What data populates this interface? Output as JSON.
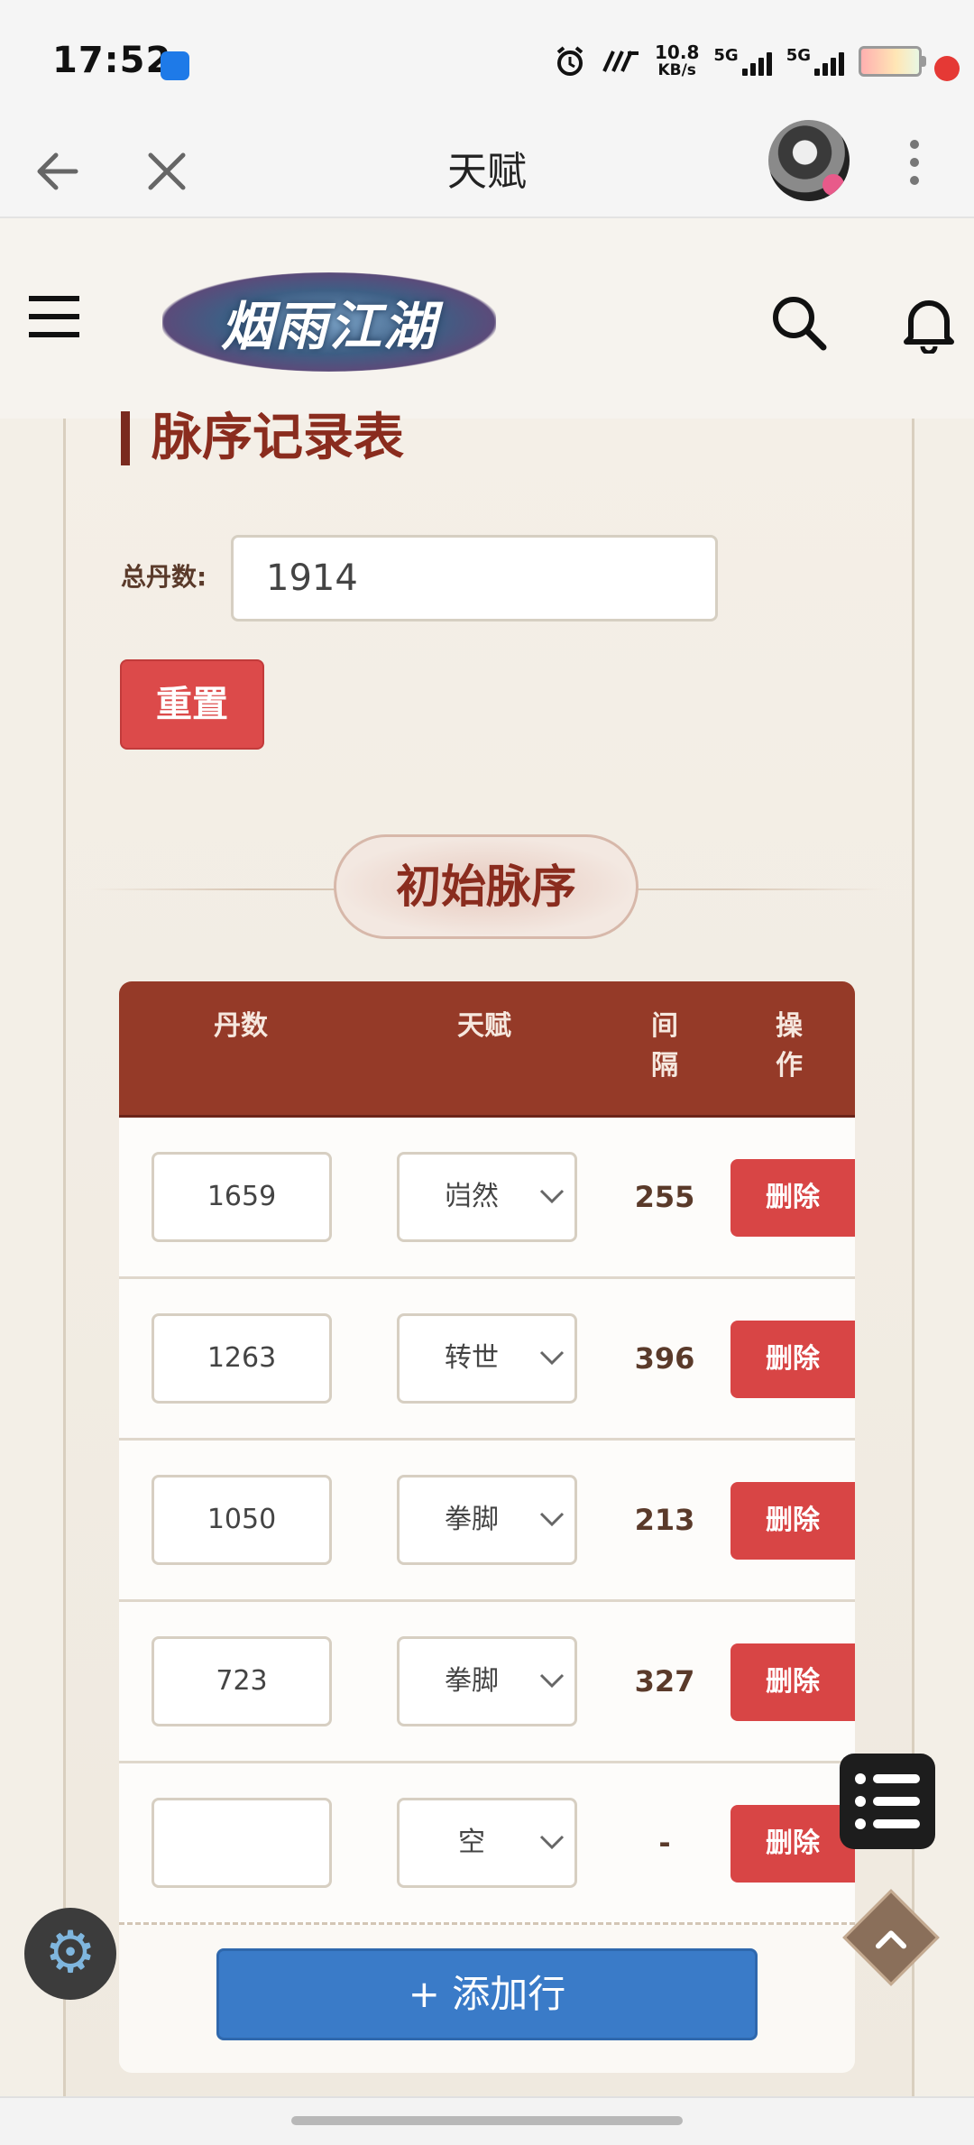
{
  "status_bar": {
    "time": "17:52",
    "net_speed": "10.8",
    "net_unit": "KB/s",
    "sim1": "5G",
    "sim2": "5G"
  },
  "app_bar": {
    "title": "天赋"
  },
  "site": {
    "logo_text": "烟雨江湖"
  },
  "page": {
    "section_title": "脉序记录表",
    "total_label": "总丹数:",
    "total_value": "1914",
    "reset_label": "重置",
    "initial_section_label": "初始脉序"
  },
  "table": {
    "headers": {
      "dan": "丹数",
      "talent": "天赋",
      "gap_line1": "间",
      "gap_line2": "隔",
      "op_line1": "操",
      "op_line2": "作"
    },
    "rows": [
      {
        "dan": "1659",
        "talent": "岿然",
        "gap": "255",
        "action": "删除"
      },
      {
        "dan": "1263",
        "talent": "转世",
        "gap": "396",
        "action": "删除"
      },
      {
        "dan": "1050",
        "talent": "拳脚",
        "gap": "213",
        "action": "删除"
      },
      {
        "dan": "723",
        "talent": "拳脚",
        "gap": "327",
        "action": "删除"
      },
      {
        "dan": "",
        "talent": "空",
        "gap": "-",
        "action": "删除"
      }
    ],
    "add_row_label": "+ 添加行"
  }
}
